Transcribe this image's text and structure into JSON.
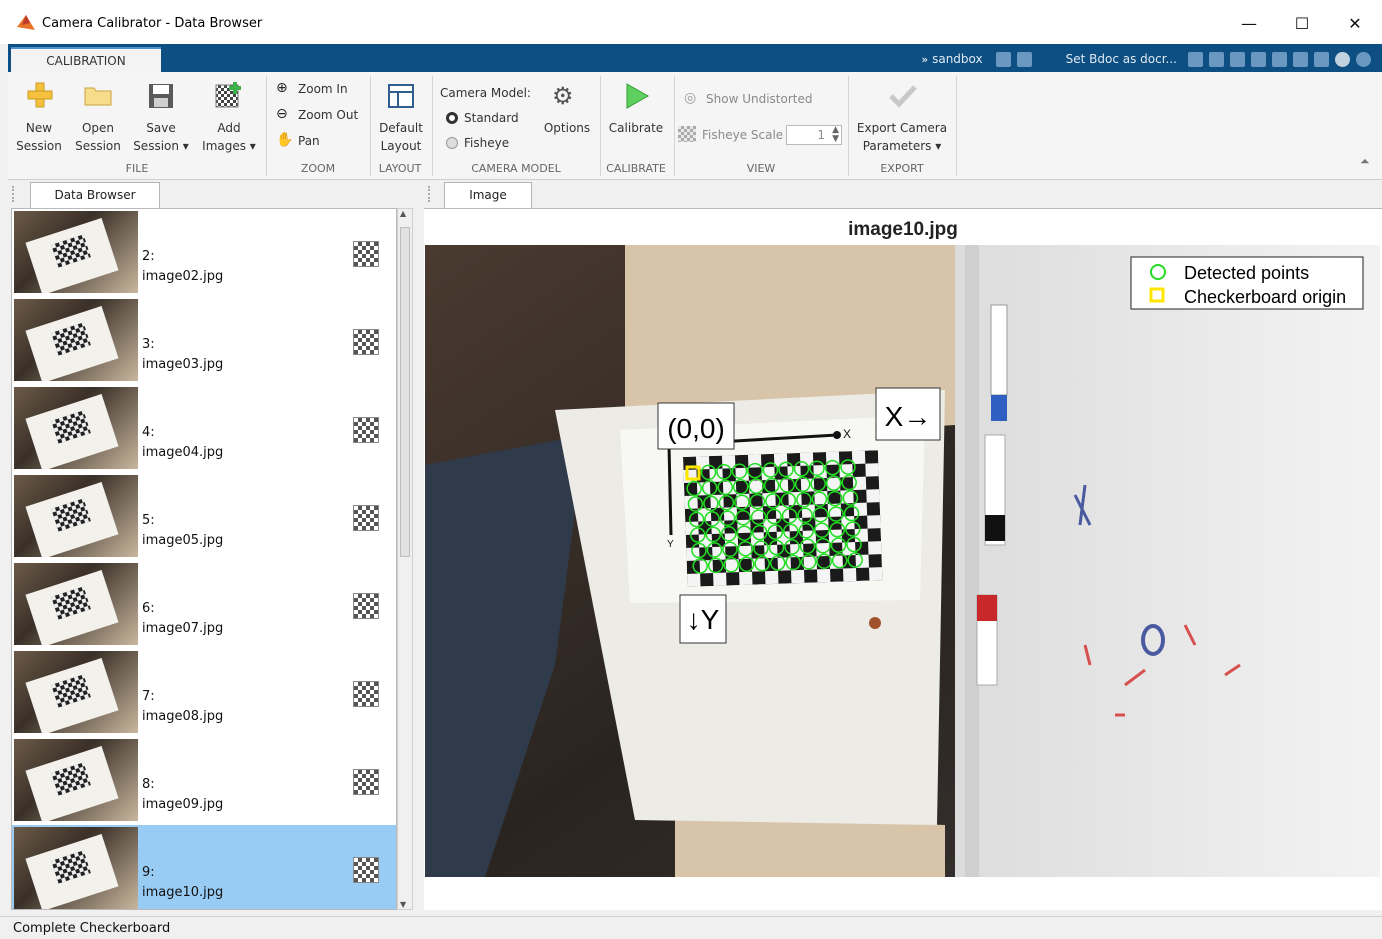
{
  "window": {
    "title": "Camera Calibrator - Data Browser",
    "controls": {
      "minimize": "—",
      "maximize": "☐",
      "close": "✕"
    }
  },
  "ribbon": {
    "tab": "CALIBRATION",
    "quick_access": {
      "sandbox": "sandbox",
      "doc_label": "Set Bdoc as docr..."
    },
    "file": {
      "group": "FILE",
      "new_session": [
        "New",
        "Session"
      ],
      "open_session": [
        "Open",
        "Session"
      ],
      "save_session": [
        "Save",
        "Session ▾"
      ],
      "add_images": [
        "Add",
        "Images ▾"
      ]
    },
    "zoom": {
      "group": "ZOOM",
      "zoom_in": "Zoom In",
      "zoom_out": "Zoom Out",
      "pan": "Pan"
    },
    "layout": {
      "group": "LAYOUT",
      "default_layout": [
        "Default",
        "Layout"
      ]
    },
    "camera_model": {
      "group": "CAMERA MODEL",
      "label": "Camera Model:",
      "standard": "Standard",
      "fisheye": "Fisheye",
      "options": "Options",
      "selected": "Standard"
    },
    "calibrate": {
      "group": "CALIBRATE",
      "button": "Calibrate"
    },
    "view": {
      "group": "VIEW",
      "show_undistorted": "Show Undistorted",
      "fisheye_scale_label": "Fisheye Scale",
      "fisheye_scale_value": "1"
    },
    "export": {
      "group": "EXPORT",
      "button": [
        "Export Camera",
        "Parameters ▾"
      ]
    }
  },
  "data_browser": {
    "tab": "Data Browser",
    "items": [
      {
        "index": "2:",
        "file": "image02.jpg",
        "selected": false
      },
      {
        "index": "3:",
        "file": "image03.jpg",
        "selected": false
      },
      {
        "index": "4:",
        "file": "image04.jpg",
        "selected": false
      },
      {
        "index": "5:",
        "file": "image05.jpg",
        "selected": false
      },
      {
        "index": "6:",
        "file": "image07.jpg",
        "selected": false
      },
      {
        "index": "7:",
        "file": "image08.jpg",
        "selected": false
      },
      {
        "index": "8:",
        "file": "image09.jpg",
        "selected": false
      },
      {
        "index": "9:",
        "file": "image10.jpg",
        "selected": true
      }
    ]
  },
  "image_panel": {
    "tab": "Image",
    "title": "image10.jpg",
    "legend": {
      "detected": "Detected points",
      "origin": "Checkerboard origin"
    },
    "annotations": {
      "origin": "(0,0)",
      "x_axis": "X→",
      "y_axis": "↓Y",
      "small_x": "X",
      "small_y": "Y"
    }
  },
  "status": {
    "text": "Complete Checkerboard"
  },
  "colors": {
    "ribbon_tab_strip": "#0d4f82",
    "selection": "#99ccf5",
    "detected_point": "#22dd22",
    "origin_marker": "#ffe600"
  }
}
